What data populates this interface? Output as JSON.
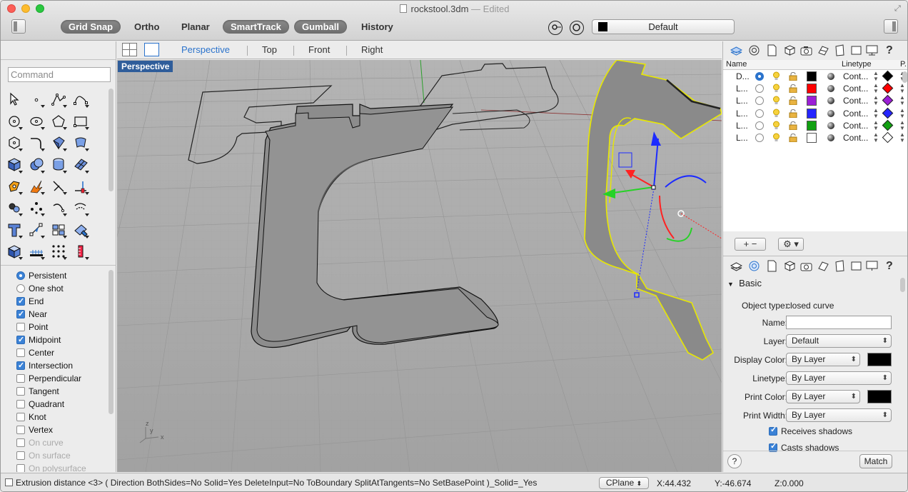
{
  "window": {
    "file_name": "rockstool.3dm",
    "status_suffix": "— Edited"
  },
  "toolbar": {
    "modes": [
      {
        "label": "Grid Snap",
        "on": true
      },
      {
        "label": "Ortho",
        "on": false
      },
      {
        "label": "Planar",
        "on": false
      },
      {
        "label": "SmartTrack",
        "on": true
      },
      {
        "label": "Gumball",
        "on": true
      },
      {
        "label": "History",
        "on": false
      }
    ],
    "current_layer": "Default"
  },
  "viewport_tabs": {
    "tabs": [
      "Perspective",
      "Top",
      "Front",
      "Right"
    ],
    "active": "Perspective"
  },
  "viewport": {
    "label": "Perspective",
    "axis_labels": {
      "x": "x",
      "y": "y",
      "z": "z"
    }
  },
  "command": {
    "placeholder": "Command"
  },
  "snaps": [
    {
      "label": "Persistent",
      "type": "radio",
      "checked": true,
      "enabled": true
    },
    {
      "label": "One shot",
      "type": "radio",
      "checked": false,
      "enabled": true
    },
    {
      "label": "End",
      "type": "check",
      "checked": true,
      "enabled": true
    },
    {
      "label": "Near",
      "type": "check",
      "checked": true,
      "enabled": true
    },
    {
      "label": "Point",
      "type": "check",
      "checked": false,
      "enabled": true
    },
    {
      "label": "Midpoint",
      "type": "check",
      "checked": true,
      "enabled": true
    },
    {
      "label": "Center",
      "type": "check",
      "checked": false,
      "enabled": true
    },
    {
      "label": "Intersection",
      "type": "check",
      "checked": true,
      "enabled": true
    },
    {
      "label": "Perpendicular",
      "type": "check",
      "checked": false,
      "enabled": true
    },
    {
      "label": "Tangent",
      "type": "check",
      "checked": false,
      "enabled": true
    },
    {
      "label": "Quadrant",
      "type": "check",
      "checked": false,
      "enabled": true
    },
    {
      "label": "Knot",
      "type": "check",
      "checked": false,
      "enabled": true
    },
    {
      "label": "Vertex",
      "type": "check",
      "checked": false,
      "enabled": true
    },
    {
      "label": "On curve",
      "type": "check",
      "checked": false,
      "enabled": false
    },
    {
      "label": "On surface",
      "type": "check",
      "checked": false,
      "enabled": false
    },
    {
      "label": "On polysurface",
      "type": "check",
      "checked": false,
      "enabled": false
    }
  ],
  "layers": {
    "columns": {
      "name": "Name",
      "linetype": "Linetype",
      "print": "P.."
    },
    "rows": [
      {
        "name": "D...",
        "current": true,
        "color": "#000000",
        "linetype": "Cont...",
        "print_color": "#000000"
      },
      {
        "name": "L...",
        "current": false,
        "color": "#ff0000",
        "linetype": "Cont...",
        "print_color": "#ff0000"
      },
      {
        "name": "L...",
        "current": false,
        "color": "#9b1fd6",
        "linetype": "Cont...",
        "print_color": "#9b1fd6"
      },
      {
        "name": "L...",
        "current": false,
        "color": "#2525ff",
        "linetype": "Cont...",
        "print_color": "#2525ff"
      },
      {
        "name": "L...",
        "current": false,
        "color": "#11a011",
        "linetype": "Cont...",
        "print_color": "#11a011"
      },
      {
        "name": "L...",
        "current": false,
        "color": "#ffffff",
        "linetype": "Cont...",
        "print_color": "#ffffff"
      }
    ],
    "add_remove": "+  −",
    "gear": "⚙ ▾"
  },
  "properties": {
    "section": "Basic",
    "object_type_label": "Object type:",
    "object_type": "closed curve",
    "name_label": "Name:",
    "name_value": "",
    "layer_label": "Layer:",
    "layer_value": "Default",
    "display_color_label": "Display Color:",
    "display_color_value": "By Layer",
    "linetype_label": "Linetype:",
    "linetype_value": "By Layer",
    "print_color_label": "Print Color:",
    "print_color_value": "By Layer",
    "print_width_label": "Print Width:",
    "print_width_value": "By Layer",
    "receives_shadows": "Receives shadows",
    "casts_shadows": "Casts shadows",
    "help": "?",
    "match": "Match"
  },
  "status": {
    "command_line": "Extrusion distance <3> ( Direction BothSides=No Solid=Yes DeleteInput=No ToBoundary SplitAtTangents=No SetBasePoint )_Solid=_Yes",
    "cplane": "CPlane",
    "x": "X:44.432",
    "y": "Y:-46.674",
    "z": "Z:0.000"
  },
  "colors": {
    "accent": "#2b73cc",
    "viewport_bg": "#a4a4a4",
    "selection": "#ffff00"
  }
}
